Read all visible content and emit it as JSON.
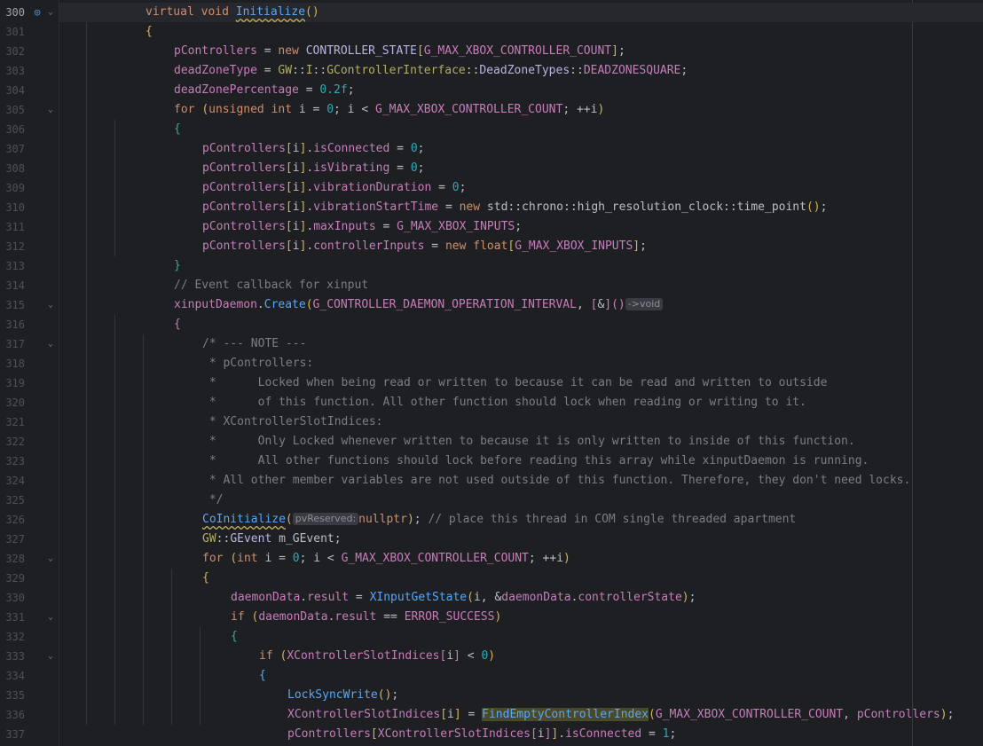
{
  "lines": [
    {
      "n": "300",
      "current": true,
      "fold": "⌄",
      "impl": true,
      "indent": 0,
      "html": "<span class='kw'>virtual void</span> <span class='fn underline'>Initialize</span><span class='br1'>()</span>"
    },
    {
      "n": "301",
      "indent": 0,
      "html": "<span class='br1'>{</span>"
    },
    {
      "n": "302",
      "indent": 1,
      "html": "<span class='member'>pControllers</span> = <span class='kw'>new</span> <span class='ty'>CONTROLLER_STATE</span><span class='br1'>[</span><span class='mac'>G_MAX_XBOX_CONTROLLER_COUNT</span><span class='br1'>]</span>;"
    },
    {
      "n": "303",
      "indent": 1,
      "html": "<span class='member'>deadZoneType</span> = <span class='ns'>GW</span>::<span class='ns'>I</span>::<span class='ns'>GControllerInterface</span>::<span class='ty'>DeadZoneTypes</span>::<span class='enum'>DEADZONESQUARE</span>;"
    },
    {
      "n": "304",
      "indent": 1,
      "html": "<span class='member'>deadZonePercentage</span> = <span class='num'>0.2f</span>;"
    },
    {
      "n": "305",
      "fold": "⌄",
      "indent": 1,
      "html": "<span class='kw'>for</span> <span class='br1'>(</span><span class='kw'>unsigned int</span> i = <span class='num'>0</span>; i &lt; <span class='mac'>G_MAX_XBOX_CONTROLLER_COUNT</span>; ++i<span class='br1'>)</span>"
    },
    {
      "n": "306",
      "indent": 1,
      "html": "<span class='br4'>{</span>"
    },
    {
      "n": "307",
      "indent": 2,
      "html": "<span class='member'>pControllers</span><span class='br1'>[</span>i<span class='br1'>]</span>.<span class='member'>isConnected</span> = <span class='num'>0</span>;"
    },
    {
      "n": "308",
      "indent": 2,
      "html": "<span class='member'>pControllers</span><span class='br1'>[</span>i<span class='br1'>]</span>.<span class='member'>isVibrating</span> = <span class='num'>0</span>;"
    },
    {
      "n": "309",
      "indent": 2,
      "html": "<span class='member'>pControllers</span><span class='br1'>[</span>i<span class='br1'>]</span>.<span class='member'>vibrationDuration</span> = <span class='num'>0</span>;"
    },
    {
      "n": "310",
      "indent": 2,
      "html": "<span class='member'>pControllers</span><span class='br1'>[</span>i<span class='br1'>]</span>.<span class='member'>vibrationStartTime</span> = <span class='kw'>new</span> std::chrono::high_resolution_clock::time_point<span class='br1'>()</span>;"
    },
    {
      "n": "311",
      "indent": 2,
      "html": "<span class='member'>pControllers</span><span class='br1'>[</span>i<span class='br1'>]</span>.<span class='member'>maxInputs</span> = <span class='mac'>G_MAX_XBOX_INPUTS</span>;"
    },
    {
      "n": "312",
      "indent": 2,
      "html": "<span class='member'>pControllers</span><span class='br1'>[</span>i<span class='br1'>]</span>.<span class='member'>controllerInputs</span> = <span class='kw'>new float</span><span class='br1'>[</span><span class='mac'>G_MAX_XBOX_INPUTS</span><span class='br1'>]</span>;"
    },
    {
      "n": "313",
      "indent": 1,
      "html": "<span class='br4'>}</span>"
    },
    {
      "n": "314",
      "indent": 1,
      "html": "<span class='cm'>// Event callback for xinput</span>"
    },
    {
      "n": "315",
      "fold": "⌄",
      "indent": 1,
      "html": "<span class='member'>xinputDaemon</span>.<span class='fn'>Create</span><span class='br1'>(</span><span class='mac'>G_CONTROLLER_DAEMON_OPERATION_INTERVAL</span>, <span class='br2'>[</span>&amp;<span class='br2'>]</span><span class='br2'>()</span><span class='hint'>-&gt;void</span>"
    },
    {
      "n": "316",
      "indent": 1,
      "html": "<span class='br2'>{</span>"
    },
    {
      "n": "317",
      "fold": "⌄",
      "indent": 2,
      "html": "<span class='cm'>/* --- NOTE ---</span>"
    },
    {
      "n": "318",
      "indent": 2,
      "html": "<span class='cm'> * pControllers:</span>"
    },
    {
      "n": "319",
      "indent": 2,
      "html": "<span class='cm'> *      Locked when being read or written to because it can be read and written to outside</span>"
    },
    {
      "n": "320",
      "indent": 2,
      "html": "<span class='cm'> *      of this function. All other function should lock when reading or writing to it.</span>"
    },
    {
      "n": "321",
      "indent": 2,
      "html": "<span class='cm'> * XControllerSlotIndices:</span>"
    },
    {
      "n": "322",
      "indent": 2,
      "html": "<span class='cm'> *      Only Locked whenever written to because it is only written to inside of this function.</span>"
    },
    {
      "n": "323",
      "indent": 2,
      "html": "<span class='cm'> *      All other functions should lock before reading this array while xinputDaemon is running.</span>"
    },
    {
      "n": "324",
      "indent": 2,
      "html": "<span class='cm'> * All other member variables are not used outside of this function. Therefore, they don't need locks.</span>"
    },
    {
      "n": "325",
      "indent": 2,
      "html": "<span class='cm'> */</span>"
    },
    {
      "n": "326",
      "indent": 2,
      "html": "<span class='fn underline'>CoInitialize</span><span class='br1'>(</span><span class='hint'>pvReserved:</span><span class='kw'>nullptr</span><span class='br1'>)</span>; <span class='cm'>// place this thread in COM single threaded apartment</span>"
    },
    {
      "n": "327",
      "indent": 2,
      "html": "<span class='ns'>GW</span>::<span class='ty'>GEvent</span> m_GEvent;"
    },
    {
      "n": "328",
      "fold": "⌄",
      "indent": 2,
      "html": "<span class='kw'>for</span> <span class='br1'>(</span><span class='kw'>int</span> i = <span class='num'>0</span>; i &lt; <span class='mac'>G_MAX_XBOX_CONTROLLER_COUNT</span>; ++i<span class='br1'>)</span>"
    },
    {
      "n": "329",
      "indent": 2,
      "html": "<span class='br1'>{</span>"
    },
    {
      "n": "330",
      "indent": 3,
      "html": "<span class='member'>daemonData</span>.<span class='member'>result</span> = <span class='fn'>XInputGetState</span><span class='br1'>(</span>i, &amp;<span class='member'>daemonData</span>.<span class='member'>controllerState</span><span class='br1'>)</span>;"
    },
    {
      "n": "331",
      "fold": "⌄",
      "indent": 3,
      "html": "<span class='kw'>if</span> <span class='br1'>(</span><span class='member'>daemonData</span>.<span class='member'>result</span> == <span class='mac'>ERROR_SUCCESS</span><span class='br1'>)</span>"
    },
    {
      "n": "332",
      "indent": 3,
      "html": "<span class='br4'>{</span>"
    },
    {
      "n": "333",
      "fold": "⌄",
      "indent": 4,
      "html": "<span class='kw'>if</span> <span class='br1'>(</span><span class='member'>XControllerSlotIndices</span><span class='br2'>[</span>i<span class='br2'>]</span> &lt; <span class='num'>0</span><span class='br1'>)</span>"
    },
    {
      "n": "334",
      "indent": 4,
      "html": "<span class='br3'>{</span>"
    },
    {
      "n": "335",
      "indent": 5,
      "html": "<span class='fn'>LockSyncWrite</span><span class='br1'>()</span>;"
    },
    {
      "n": "336",
      "indent": 5,
      "html": "<span class='member'>XControllerSlotIndices</span><span class='br1'>[</span>i<span class='br1'>]</span> = <span class='fn hl'>FindEmptyControllerIndex</span><span class='br1'>(</span><span class='mac'>G_MAX_XBOX_CONTROLLER_COUNT</span>, <span class='member'>pControllers</span><span class='br1'>)</span>;"
    },
    {
      "n": "337",
      "indent": 5,
      "html": "<span class='member'>pControllers</span><span class='br1'>[</span><span class='member'>XControllerSlotIndices</span><span class='br2'>[</span>i<span class='br2'>]</span><span class='br1'>]</span>.<span class='member'>isConnected</span> = <span class='num'>1</span>;"
    }
  ]
}
